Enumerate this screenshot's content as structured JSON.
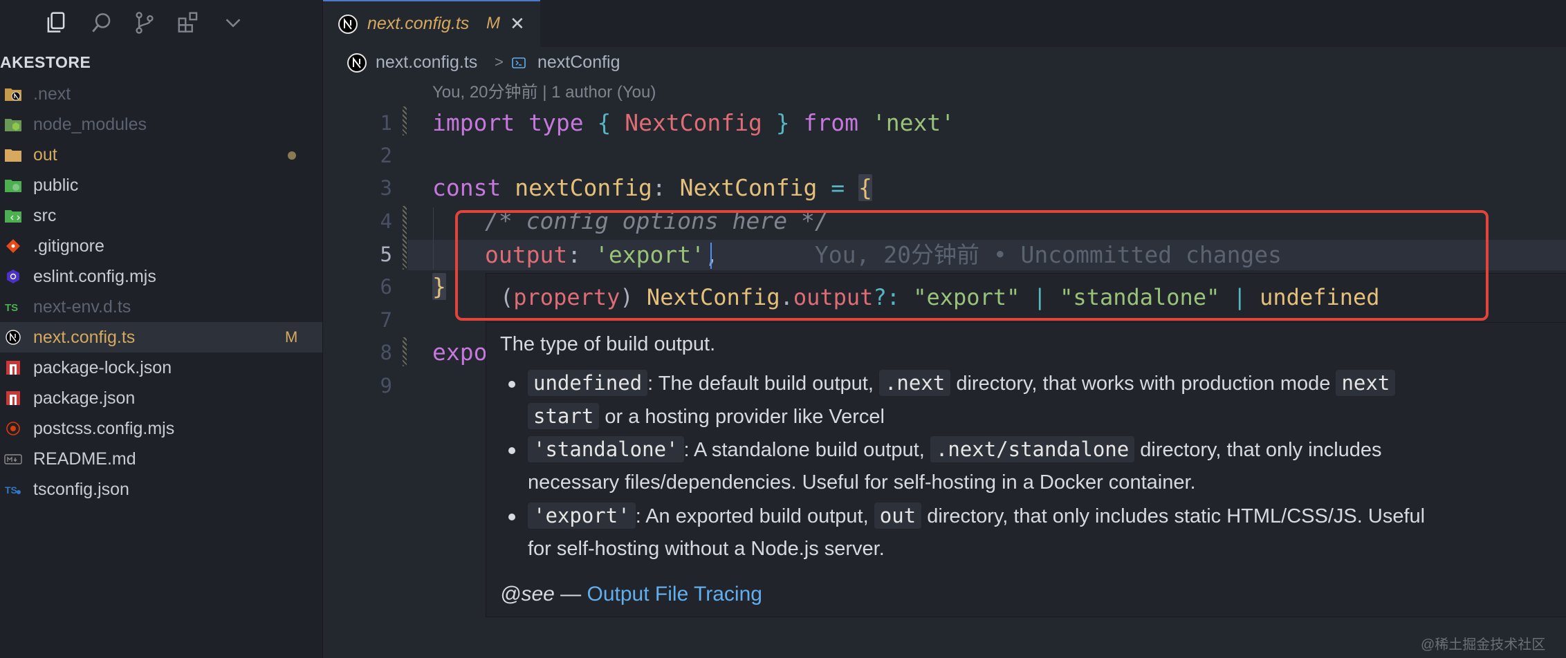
{
  "sidebar": {
    "explorer_title": "AKESTORE",
    "files": [
      {
        "name": ".next",
        "icon": "nextjs-folder-icon",
        "color": "#5c6370",
        "badge": ""
      },
      {
        "name": "node_modules",
        "icon": "node-folder-icon",
        "color": "#5c6370",
        "badge": ""
      },
      {
        "name": "out",
        "icon": "folder-icon",
        "color": "#d6a95f",
        "badge": "dot"
      },
      {
        "name": "public",
        "icon": "public-folder-icon",
        "color": "#c8ccd4",
        "badge": ""
      },
      {
        "name": "src",
        "icon": "src-folder-icon",
        "color": "#c8ccd4",
        "badge": ""
      },
      {
        "name": ".gitignore",
        "icon": "git-icon",
        "color": "#c8ccd4",
        "badge": ""
      },
      {
        "name": "eslint.config.mjs",
        "icon": "eslint-icon",
        "color": "#c8ccd4",
        "badge": ""
      },
      {
        "name": "next-env.d.ts",
        "icon": "typescript-icon",
        "color": "#5c6370",
        "badge": ""
      },
      {
        "name": "next.config.ts",
        "icon": "nextjs-icon",
        "color": "#d6a95f",
        "badge": "M"
      },
      {
        "name": "package-lock.json",
        "icon": "npm-icon",
        "color": "#c8ccd4",
        "badge": ""
      },
      {
        "name": "package.json",
        "icon": "npm-icon",
        "color": "#c8ccd4",
        "badge": ""
      },
      {
        "name": "postcss.config.mjs",
        "icon": "postcss-icon",
        "color": "#c8ccd4",
        "badge": ""
      },
      {
        "name": "README.md",
        "icon": "markdown-icon",
        "color": "#c8ccd4",
        "badge": ""
      },
      {
        "name": "tsconfig.json",
        "icon": "tsconfig-icon",
        "color": "#c8ccd4",
        "badge": ""
      }
    ]
  },
  "tab": {
    "title": "next.config.ts",
    "status": "M",
    "close": "✕"
  },
  "breadcrumb": {
    "file": "next.config.ts",
    "separator": ">",
    "symbol": "nextConfig"
  },
  "codelens": "You, 20分钟前 | 1 author (You)",
  "line_numbers": [
    "1",
    "2",
    "3",
    "4",
    "5",
    "6",
    "7",
    "8",
    "9"
  ],
  "code": {
    "l1": {
      "kw_import": "import",
      "kw_type": "type",
      "open": "{",
      "type_name": "NextConfig",
      "close": "}",
      "kw_from": "from",
      "module": "'next'"
    },
    "l3": {
      "kw_const": "const",
      "var_name": "nextConfig",
      "colon": ":",
      "type_name": "NextConfig",
      "eq": "=",
      "brace": "{"
    },
    "l4": {
      "comment": "/* config options here */"
    },
    "l5": {
      "prop": "output",
      "colon": ":",
      "value": "'export'",
      "comma": ",",
      "blame": "You, 20分钟前 • Uncommitted changes"
    },
    "l6": {
      "brace": "}"
    },
    "l8": {
      "text": "expo"
    }
  },
  "hover": {
    "sig": {
      "open": "(",
      "kind": "property",
      "close": ")",
      "owner": "NextConfig",
      "dot": ".",
      "member": "output",
      "optional": "?:",
      "t1": "\"export\"",
      "bar1": "|",
      "t2": "\"standalone\"",
      "bar2": "|",
      "t3": "undefined"
    },
    "description": "The type of build output.",
    "bullets": [
      {
        "code": "undefined",
        "text1": ": The default build output,",
        "code2": ".next",
        "text2": "directory, that works with production mode",
        "code3": "next",
        "cont_code": "start",
        "cont_text": "or a hosting provider like Vercel"
      },
      {
        "code": "'standalone'",
        "text1": ": A standalone build output,",
        "code2": ".next/standalone",
        "text2": "directory, that only includes",
        "cont_text": "necessary files/dependencies. Useful for self-hosting in a Docker container."
      },
      {
        "code": "'export'",
        "text1": ": An exported build output,",
        "code2": "out",
        "text2": "directory, that only includes static HTML/CSS/JS. Useful",
        "cont_text": "for self-hosting without a Node.js server."
      }
    ],
    "see_tag": "@see",
    "see_dash": "—",
    "see_link": "Output File Tracing"
  },
  "watermark": "@稀土掘金技术社区",
  "colors": {
    "accent": "#4d78cc",
    "modified": "#d6a95f",
    "highlight_box": "#e0443a",
    "link": "#61afef"
  }
}
